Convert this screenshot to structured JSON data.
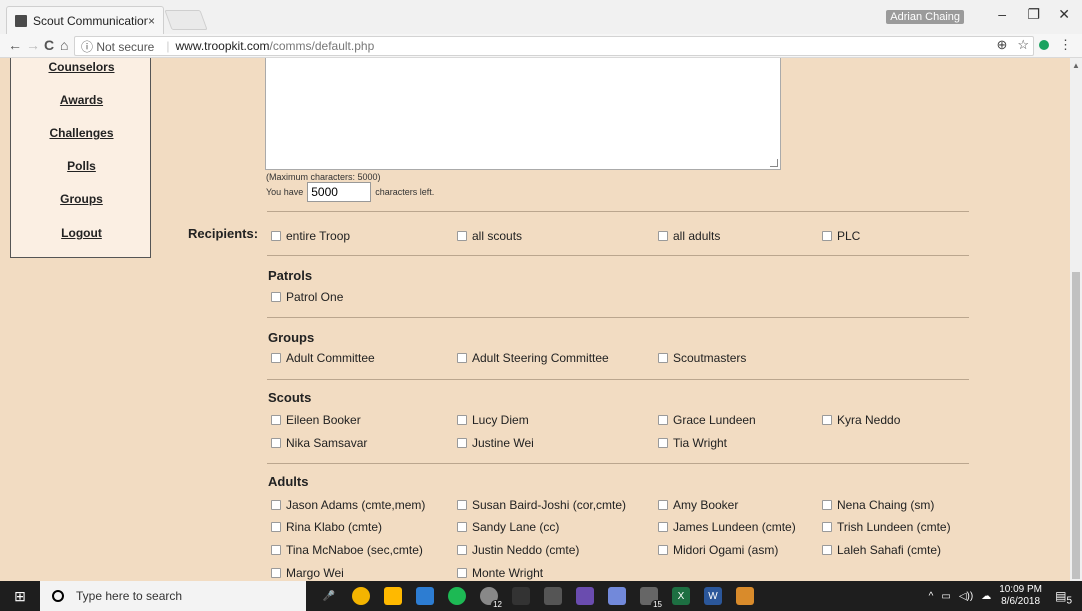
{
  "browser": {
    "tab_title": "Scout Communications",
    "tab_close": "×",
    "user_name": "Adrian Chaing",
    "minimize": "–",
    "restore": "❐",
    "close": "✕",
    "back": "←",
    "forward": "→",
    "reload": "C",
    "home": "⌂",
    "security_label": "ⓘ Not secure",
    "url_host": "www.troopkit.com",
    "url_path": "/comms/default.php",
    "zoom_icon": "⊕",
    "star_icon": "☆",
    "menu_icon": "⋮"
  },
  "sidebar": {
    "items": [
      {
        "label": "Counselors"
      },
      {
        "label": "Awards"
      },
      {
        "label": "Challenges"
      },
      {
        "label": "Polls"
      },
      {
        "label": "Groups"
      },
      {
        "label": "Logout"
      }
    ]
  },
  "message": {
    "max_chars_text": "(Maximum characters: 5000)",
    "you_have": "You have",
    "chars_left_value": "5000",
    "chars_left_suffix": "characters left."
  },
  "recipients": {
    "label": "Recipients:",
    "general": [
      "entire Troop",
      "all scouts",
      "all adults",
      "PLC"
    ],
    "patrols_title": "Patrols",
    "patrols": [
      "Patrol One"
    ],
    "groups_title": "Groups",
    "groups": [
      "Adult Committee",
      "Adult Steering Committee",
      "Scoutmasters"
    ],
    "scouts_title": "Scouts",
    "scouts": [
      "Eileen Booker",
      "Lucy Diem",
      "Grace Lundeen",
      "Kyra Neddo",
      "Nika Samsavar",
      "Justine Wei",
      "Tia Wright"
    ],
    "adults_title": "Adults",
    "adults": [
      "Jason Adams (cmte,mem)",
      "Susan Baird-Joshi (cor,cmte)",
      "Amy Booker",
      "Nena Chaing (sm)",
      "Rina Klabo (cmte)",
      "Sandy Lane (cc)",
      "James Lundeen (cmte)",
      "Trish Lundeen (cmte)",
      "Tina McNaboe (sec,cmte)",
      "Justin Neddo (cmte)",
      "Midori Ogami (asm)",
      "Laleh Sahafi (cmte)",
      "Margo Wei",
      "Monte Wright"
    ]
  },
  "taskbar": {
    "search_placeholder": "Type here to search",
    "time": "10:09 PM",
    "date": "8/6/2018",
    "badge_xbox": "12",
    "badge_mail": "15",
    "notif_count": "5",
    "colors": {
      "bar": "#1e1e1e",
      "chrome": "#f4b400",
      "explorer": "#ffb900",
      "spotify": "#1db954",
      "excel": "#1d6f42",
      "word": "#2b579a"
    }
  }
}
